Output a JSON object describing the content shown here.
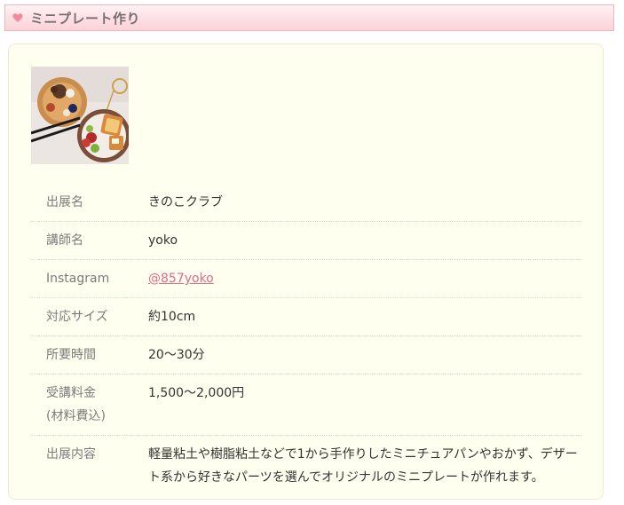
{
  "header": {
    "title": "ミニプレート作り",
    "icon": "heart-icon",
    "accent_color": "#f08b99"
  },
  "card": {
    "photo_alt": "ミニプレート作品写真",
    "rows": [
      {
        "label": "出展名",
        "value": "きのこクラブ"
      },
      {
        "label": "講師名",
        "value": "yoko"
      },
      {
        "label": "Instagram",
        "value": "@857yoko"
      },
      {
        "label": "対応サイズ",
        "value": "約10cm"
      },
      {
        "label": "所要時間",
        "value": "20〜30分"
      },
      {
        "label_line1": "受講料金",
        "label_line2": "(材料費込)",
        "value": "1,500〜2,000円"
      },
      {
        "label": "出展内容",
        "value": "軽量粘土や樹脂粘土などで1から手作りしたミニチュアパンやおかず、デザート系から好きなパーツを選んでオリジナルのミニプレートが作れます。"
      }
    ]
  }
}
